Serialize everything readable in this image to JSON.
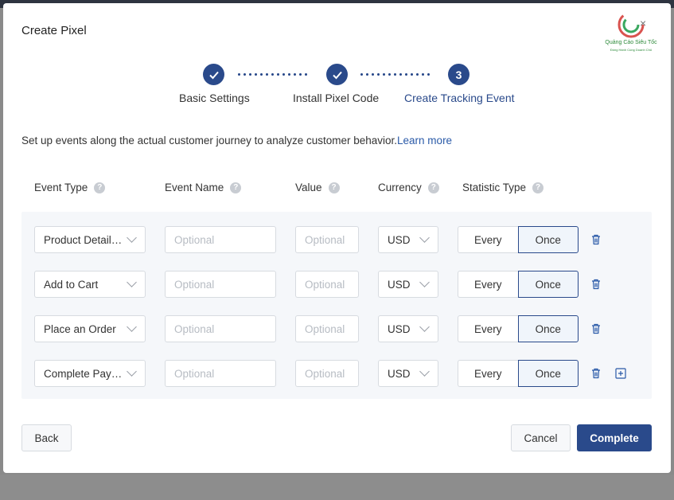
{
  "modal": {
    "title": "Create Pixel",
    "close_glyph": "×"
  },
  "logo": {
    "name": "Quảng Cáo Siêu Tốc",
    "tagline": "Đồng Hành Cùng Doanh Chủ"
  },
  "stepper": {
    "steps": [
      {
        "label": "Basic Settings",
        "state": "done",
        "icon": "check-icon"
      },
      {
        "label": "Install Pixel Code",
        "state": "done",
        "icon": "check-icon"
      },
      {
        "label": "Create Tracking Event",
        "state": "active",
        "number": "3"
      }
    ]
  },
  "intro": {
    "text": "Set up events along the actual customer journey to analyze customer behavior.",
    "link": "Learn more"
  },
  "columns": {
    "event_type": "Event Type",
    "event_name": "Event Name",
    "value": "Value",
    "currency": "Currency",
    "statistic_type": "Statistic Type",
    "help_glyph": "?"
  },
  "events": [
    {
      "event_type": "Product Details Page",
      "event_name_placeholder": "Optional",
      "value_placeholder": "Optional",
      "currency": "USD",
      "statistic_options": [
        "Every",
        "Once"
      ],
      "statistic_selected": "Once"
    },
    {
      "event_type": "Add to Cart",
      "event_name_placeholder": "Optional",
      "value_placeholder": "Optional",
      "currency": "USD",
      "statistic_options": [
        "Every",
        "Once"
      ],
      "statistic_selected": "Once"
    },
    {
      "event_type": "Place an Order",
      "event_name_placeholder": "Optional",
      "value_placeholder": "Optional",
      "currency": "USD",
      "statistic_options": [
        "Every",
        "Once"
      ],
      "statistic_selected": "Once"
    },
    {
      "event_type": "Complete Payment",
      "event_name_placeholder": "Optional",
      "value_placeholder": "Optional",
      "currency": "USD",
      "statistic_options": [
        "Every",
        "Once"
      ],
      "statistic_selected": "Once"
    }
  ],
  "footer": {
    "back": "Back",
    "cancel": "Cancel",
    "complete": "Complete"
  },
  "colors": {
    "primary": "#2a4a8b",
    "link": "#2a5aa8",
    "panel": "#f5f7fa"
  }
}
